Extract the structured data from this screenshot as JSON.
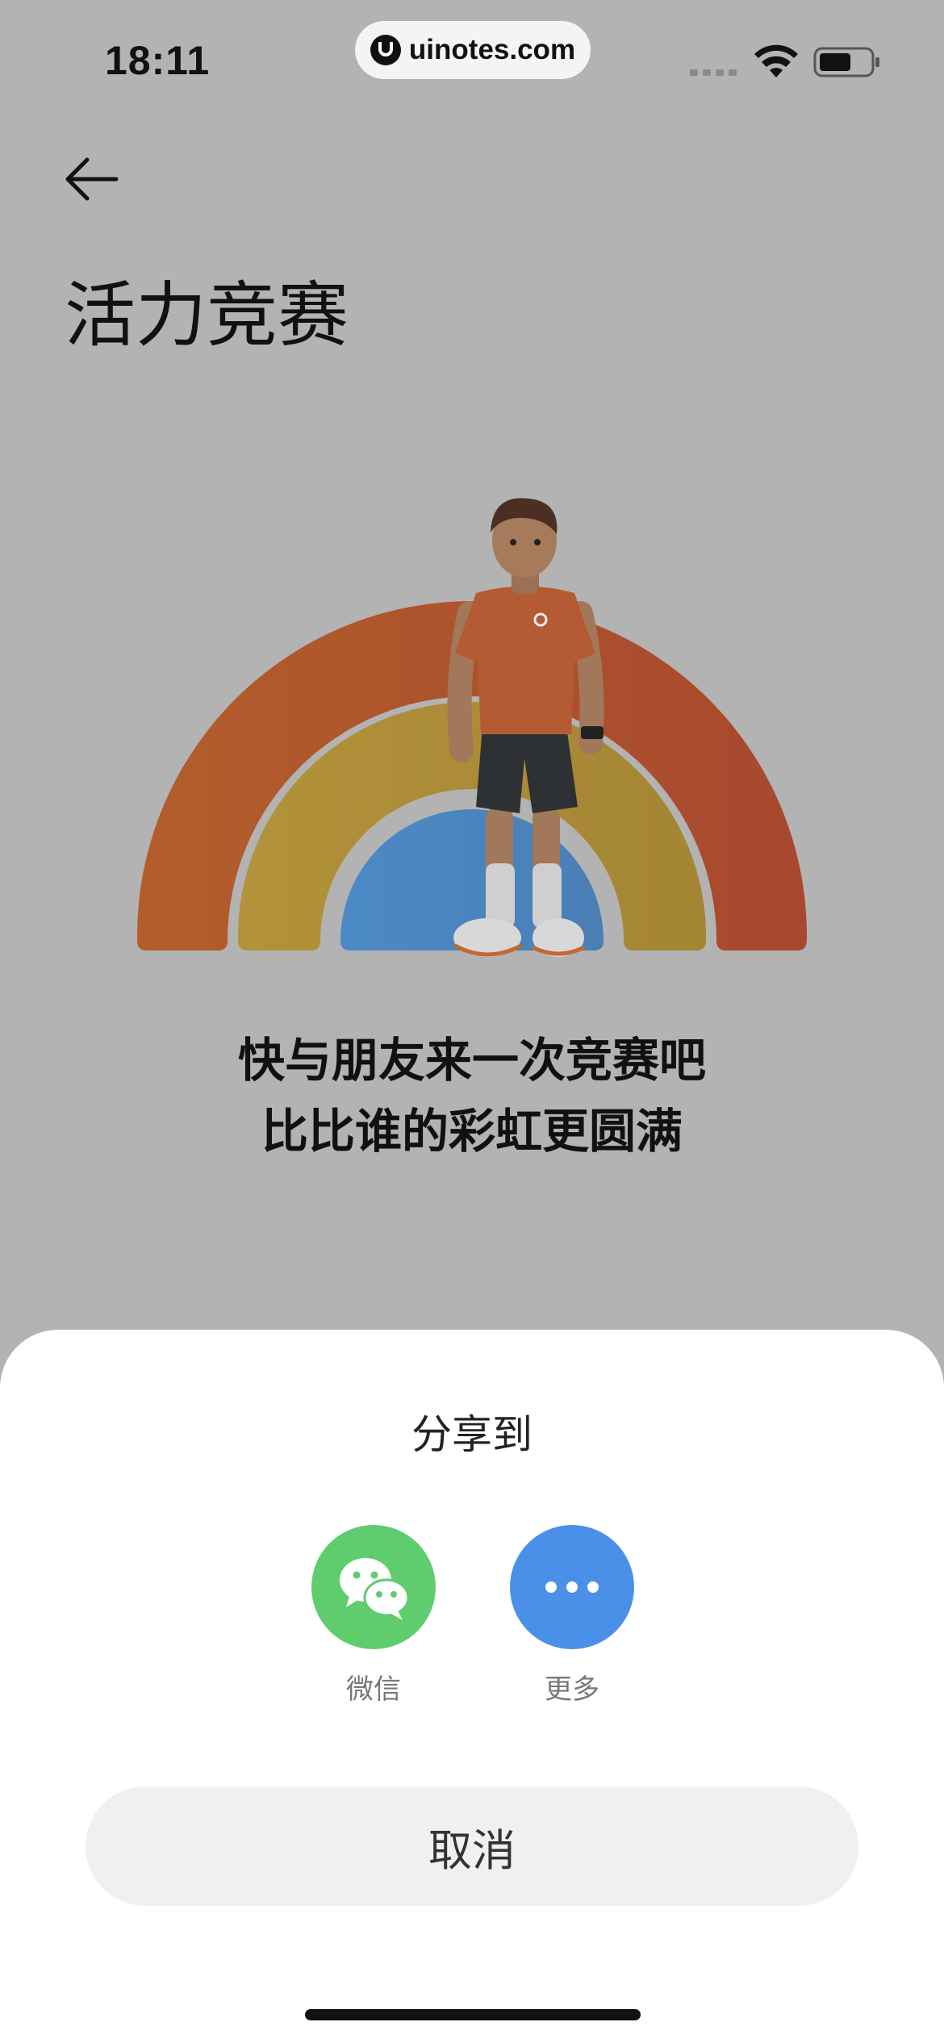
{
  "status_bar": {
    "time": "18:11",
    "url": "uinotes.com"
  },
  "header": {
    "title": "活力竞赛"
  },
  "hero": {
    "slogan_line1": "快与朋友来一次竞赛吧",
    "slogan_line2": "比比谁的彩虹更圆满",
    "colors": {
      "outer_arc": "#b0552f",
      "middle_arc": "#b09038",
      "inner_arc": "#4f86bf",
      "overlay_bg": "#b3b3b3"
    }
  },
  "share_sheet": {
    "title": "分享到",
    "options": [
      {
        "label": "微信",
        "icon": "wechat-icon",
        "color": "#5fcc6e"
      },
      {
        "label": "更多",
        "icon": "more-icon",
        "color": "#4a90e8"
      }
    ],
    "cancel_label": "取消"
  }
}
